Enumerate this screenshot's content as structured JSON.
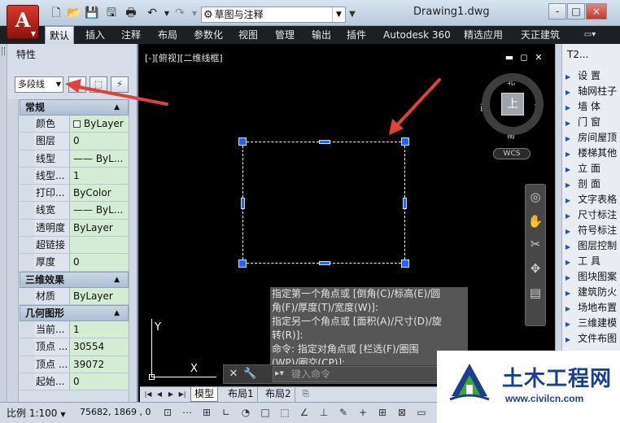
{
  "app": {
    "logo_letter": "A",
    "workspace": "草图与注释",
    "document_title": "Drawing1.dwg",
    "window_buttons": [
      "-",
      "□",
      "×"
    ]
  },
  "ribbon": {
    "tabs": [
      "默认",
      "插入",
      "注释",
      "布局",
      "参数化",
      "视图",
      "管理",
      "输出",
      "插件",
      "Autodesk 360",
      "精选应用",
      "天正建筑"
    ],
    "active": "默认"
  },
  "properties": {
    "title": "特性",
    "object_type": "多段线",
    "sections": [
      {
        "title": "常规",
        "rows": [
          {
            "label": "颜色",
            "value": "ByLayer",
            "swatch": true
          },
          {
            "label": "图层",
            "value": "0"
          },
          {
            "label": "线型",
            "value": "—— ByL..."
          },
          {
            "label": "线型...",
            "value": "1"
          },
          {
            "label": "打印...",
            "value": "ByColor"
          },
          {
            "label": "线宽",
            "value": "—— ByL..."
          },
          {
            "label": "透明度",
            "value": "ByLayer"
          },
          {
            "label": "超链接",
            "value": ""
          },
          {
            "label": "厚度",
            "value": "0"
          }
        ]
      },
      {
        "title": "三维效果",
        "rows": [
          {
            "label": "材质",
            "value": "ByLayer"
          }
        ]
      },
      {
        "title": "几何图形",
        "rows": [
          {
            "label": "当前...",
            "value": "1"
          },
          {
            "label": "顶点 ...",
            "value": "30554"
          },
          {
            "label": "顶点 ...",
            "value": "39072"
          },
          {
            "label": "起始...",
            "value": "0"
          }
        ]
      }
    ]
  },
  "viewport": {
    "label": "[-][俯视][二维线框]",
    "compass": {
      "north": "北",
      "south": "南",
      "east": "东",
      "west": "西",
      "center": "上"
    },
    "wcs": "WCS",
    "ucs_x": "X",
    "ucs_y": "Y"
  },
  "command": {
    "history": [
      "指定第一个角点或 [倒角(C)/标高(E)/圆",
      "角(F)/厚度(T)/宽度(W)]:",
      "指定另一个角点或 [面积(A)/尺寸(D)/旋",
      "转(R)]:",
      "命令: 指定对角点或 [栏选(F)/圈围",
      "(WP)/圈交(CP)]:"
    ],
    "placeholder": "键入命令"
  },
  "layout_tabs": [
    "模型",
    "布局1",
    "布局2"
  ],
  "active_layout": "模型",
  "status": {
    "scale": "比例 1:100",
    "coords": "75682, 1869 , 0"
  },
  "tool_palette": {
    "title": "T2...",
    "items": [
      "设 置",
      "轴网柱子",
      "墙 体",
      "门 窗",
      "房间屋顶",
      "楼梯其他",
      "立 面",
      "剖 面",
      "文字表格",
      "尺寸标注",
      "符号标注",
      "图层控制",
      "工 具",
      "图块图案",
      "建筑防火",
      "场地布置",
      "三维建模",
      "文件布图"
    ]
  },
  "watermark": {
    "name": "土木工程网",
    "url": "www.civilcn.com"
  },
  "colors": {
    "grip": "#1f66ff",
    "annotation_arrow": "#e0413a",
    "canvas": "#000000",
    "watermark_blue": "#1a3f8f"
  }
}
